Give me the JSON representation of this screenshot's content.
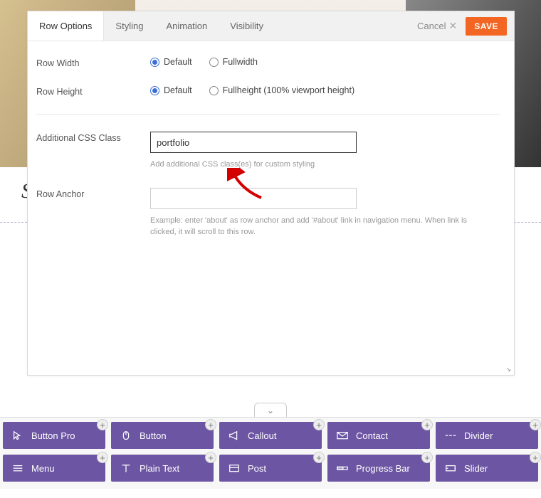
{
  "letter": "S",
  "dialog": {
    "tabs": [
      "Row Options",
      "Styling",
      "Animation",
      "Visibility"
    ],
    "active_tab": 0,
    "cancel": "Cancel",
    "save": "SAVE",
    "rows": {
      "row_width": {
        "label": "Row Width",
        "options": [
          "Default",
          "Fullwidth"
        ],
        "selected": 0
      },
      "row_height": {
        "label": "Row Height",
        "options": [
          "Default",
          "Fullheight (100% viewport height)"
        ],
        "selected": 0
      },
      "css_class": {
        "label": "Additional CSS Class",
        "value": "portfolio",
        "helper": "Add additional CSS class(es) for custom styling"
      },
      "row_anchor": {
        "label": "Row Anchor",
        "value": "",
        "helper": "Example: enter 'about' as row anchor and add '#about' link in navigation menu. When link is clicked, it will scroll to this row."
      }
    }
  },
  "elements": [
    {
      "icon": "cursor",
      "label": "Button Pro"
    },
    {
      "icon": "mouse",
      "label": "Button"
    },
    {
      "icon": "megaphone",
      "label": "Callout"
    },
    {
      "icon": "envelope",
      "label": "Contact"
    },
    {
      "icon": "dashes",
      "label": "Divider"
    },
    {
      "icon": "menu",
      "label": "Menu"
    },
    {
      "icon": "text",
      "label": "Plain Text"
    },
    {
      "icon": "post",
      "label": "Post"
    },
    {
      "icon": "progress",
      "label": "Progress Bar"
    },
    {
      "icon": "slider",
      "label": "Slider"
    }
  ]
}
